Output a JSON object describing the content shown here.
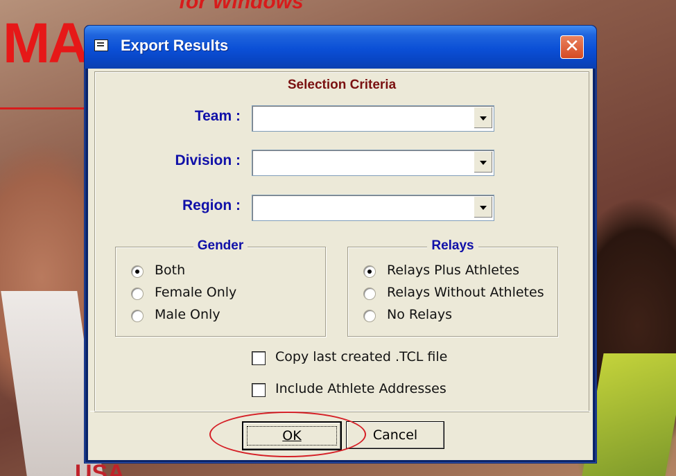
{
  "background": {
    "magazine_title": "MA",
    "magazine_subtitle": "for Windows",
    "magazine_bottom_text": "USA"
  },
  "dialog": {
    "title": "Export Results",
    "close_glyph": "✕",
    "selection_criteria_label": "Selection Criteria",
    "fields": {
      "team_label": "Team :",
      "team_value": "",
      "division_label": "Division :",
      "division_value": "",
      "region_label": "Region :",
      "region_value": ""
    },
    "gender": {
      "label": "Gender",
      "options": [
        "Both",
        "Female Only",
        "Male Only"
      ],
      "selected": "Both"
    },
    "relays": {
      "label": "Relays",
      "options": [
        "Relays Plus Athletes",
        "Relays Without Athletes",
        "No Relays"
      ],
      "selected": "Relays Plus Athletes"
    },
    "checkboxes": {
      "copy_tcl_label": "Copy last created .TCL file",
      "copy_tcl_checked": false,
      "include_addresses_label": "Include Athlete Addresses",
      "include_addresses_checked": false
    },
    "buttons": {
      "ok_label": "OK",
      "cancel_label": "Cancel"
    }
  },
  "colors": {
    "title_bar": "#0b4fd6",
    "dialog_face": "#ece9d8",
    "label_blue": "#1010a8",
    "criteria_red": "#7a1111",
    "highlight_red": "#d51f26"
  },
  "icons": [
    "window-icon",
    "close-icon",
    "dropdown-arrow-icon"
  ]
}
